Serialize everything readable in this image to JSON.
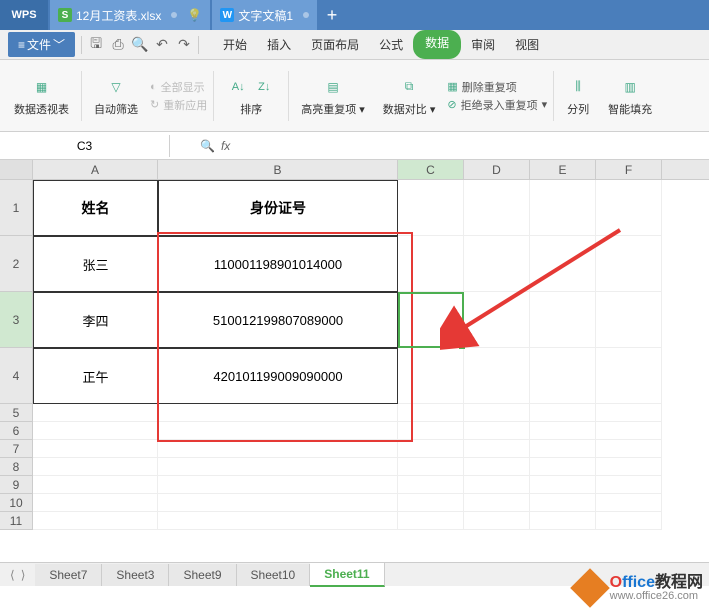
{
  "title_bar": {
    "wps": "WPS",
    "tabs": [
      {
        "icon": "S",
        "label": "12月工资表.xlsx",
        "type": "spreadsheet"
      },
      {
        "icon": "W",
        "label": "文字文稿1",
        "type": "writer"
      }
    ]
  },
  "menu": {
    "file": "文件",
    "ribbon_tabs": [
      "开始",
      "插入",
      "页面布局",
      "公式",
      "数据",
      "审阅",
      "视图"
    ],
    "active_tab": "数据"
  },
  "ribbon": {
    "pivot": "数据透视表",
    "filter": "自动筛选",
    "show_all": "全部显示",
    "reapply": "重新应用",
    "sort": "排序",
    "highlight_dup": "高亮重复项",
    "data_compare": "数据对比",
    "remove_dup": "删除重复项",
    "reject_dup": "拒绝录入重复项",
    "text_to_col": "分列",
    "smart_fill": "智能填充"
  },
  "cell_ref": {
    "name_box": "C3",
    "fx": "fx"
  },
  "columns": [
    "A",
    "B",
    "C",
    "D",
    "E",
    "F"
  ],
  "rows": [
    "1",
    "2",
    "3",
    "4",
    "5",
    "6",
    "7",
    "8",
    "9",
    "10",
    "11"
  ],
  "data": {
    "headers": {
      "A": "姓名",
      "B": "身份证号"
    },
    "body": [
      {
        "A": "张三",
        "B": "110001198901014000"
      },
      {
        "A": "李四",
        "B": "510012199807089000"
      },
      {
        "A": "正午",
        "B": "420101199009090000"
      }
    ]
  },
  "sheet_tabs": [
    "Sheet7",
    "Sheet3",
    "Sheet9",
    "Sheet10",
    "Sheet11"
  ],
  "active_sheet": "Sheet11",
  "watermark": {
    "title": "Office教程网",
    "url": "www.office26.com"
  }
}
